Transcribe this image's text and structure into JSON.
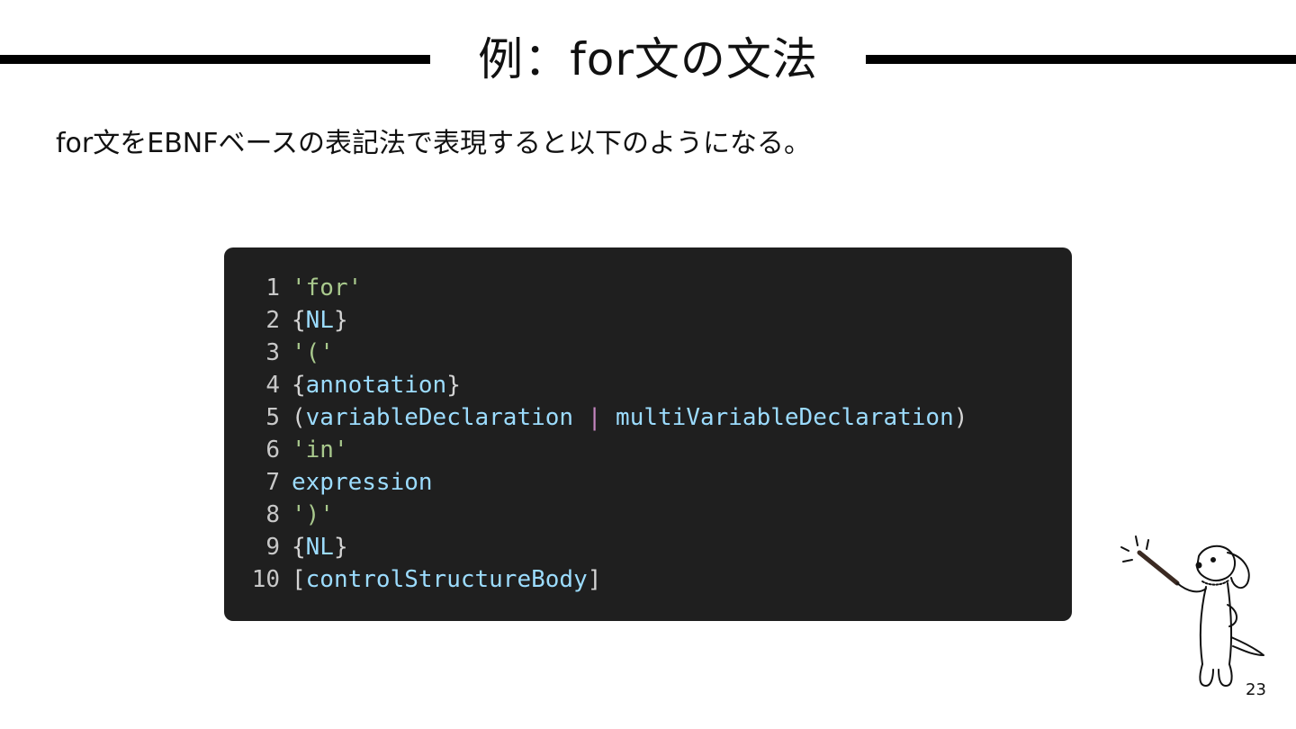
{
  "slide": {
    "title": "例：for文の文法",
    "lead": "for文をEBNFベースの表記法で表現すると以下のようになる。",
    "page_number": "23"
  },
  "code": {
    "lines": [
      {
        "num": "1",
        "tokens": [
          {
            "t": "'for'",
            "k": "str"
          }
        ]
      },
      {
        "num": "2",
        "tokens": [
          {
            "t": "{",
            "k": "punct"
          },
          {
            "t": "NL",
            "k": "id"
          },
          {
            "t": "}",
            "k": "punct"
          }
        ]
      },
      {
        "num": "3",
        "tokens": [
          {
            "t": "'('",
            "k": "str"
          }
        ]
      },
      {
        "num": "4",
        "tokens": [
          {
            "t": "{",
            "k": "punct"
          },
          {
            "t": "annotation",
            "k": "id"
          },
          {
            "t": "}",
            "k": "punct"
          }
        ]
      },
      {
        "num": "5",
        "tokens": [
          {
            "t": "(",
            "k": "punct"
          },
          {
            "t": "variableDeclaration",
            "k": "id"
          },
          {
            "t": " ",
            "k": "punct"
          },
          {
            "t": "|",
            "k": "bar"
          },
          {
            "t": " ",
            "k": "punct"
          },
          {
            "t": "multiVariableDeclaration",
            "k": "id"
          },
          {
            "t": ")",
            "k": "punct"
          }
        ]
      },
      {
        "num": "6",
        "tokens": [
          {
            "t": "'in'",
            "k": "str"
          }
        ]
      },
      {
        "num": "7",
        "tokens": [
          {
            "t": "expression",
            "k": "id"
          }
        ]
      },
      {
        "num": "8",
        "tokens": [
          {
            "t": "')'",
            "k": "str"
          }
        ]
      },
      {
        "num": "9",
        "tokens": [
          {
            "t": "{",
            "k": "punct"
          },
          {
            "t": "NL",
            "k": "id"
          },
          {
            "t": "}",
            "k": "punct"
          }
        ]
      },
      {
        "num": "10",
        "tokens": [
          {
            "t": "[",
            "k": "punct"
          },
          {
            "t": "controlStructureBody",
            "k": "id"
          },
          {
            "t": "]",
            "k": "punct"
          }
        ]
      }
    ]
  },
  "illustration": {
    "icon": "dog-with-pointer-icon"
  },
  "colors": {
    "code_background": "#1f1f1f",
    "string_literal": "#a9c98d",
    "identifier": "#9cdcfe",
    "punctuation": "#d4d4d4",
    "alternation_bar": "#c586c0",
    "line_number": "#c8c8c8"
  }
}
